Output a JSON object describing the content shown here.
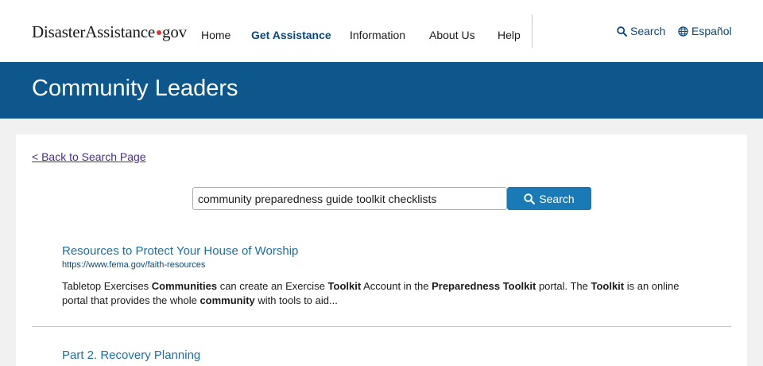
{
  "header": {
    "logo": {
      "part1": "Disaster",
      "part2": "Assistance",
      "part3": "gov"
    },
    "nav": [
      "Home",
      "Get Assistance",
      "Information",
      "About Us",
      "Help"
    ],
    "active_nav": "Get Assistance",
    "utility": {
      "search_label": "Search",
      "language_label": "Español"
    }
  },
  "banner": {
    "title": "Community Leaders"
  },
  "main": {
    "back_link": "< Back to Search Page",
    "search": {
      "value": "community preparedness guide toolkit checklists",
      "button_label": "Search"
    },
    "results": [
      {
        "title": "Resources to Protect Your House of Worship",
        "url": "https://www.fema.gov/faith-resources",
        "snippet": [
          {
            "t": "Tabletop Exercises ",
            "b": false
          },
          {
            "t": "Communities",
            "b": true
          },
          {
            "t": " can create an Exercise ",
            "b": false
          },
          {
            "t": "Toolkit",
            "b": true
          },
          {
            "t": " Account in the ",
            "b": false
          },
          {
            "t": "Preparedness Toolkit",
            "b": true
          },
          {
            "t": " portal. The ",
            "b": false
          },
          {
            "t": "Toolkit",
            "b": true
          },
          {
            "t": " is an online portal that provides the whole ",
            "b": false
          },
          {
            "t": "community",
            "b": true
          },
          {
            "t": " with tools to aid...",
            "b": false
          }
        ]
      },
      {
        "title": "Part 2. Recovery Planning"
      }
    ]
  },
  "colors": {
    "banner": "#0e578c",
    "accent": "#1a7ab5",
    "link": "#1d6ea5",
    "visited_link": "#4c2c92",
    "logo_dot": "#d83933"
  },
  "icons": {
    "search": "search-icon",
    "language": "globe-icon"
  }
}
